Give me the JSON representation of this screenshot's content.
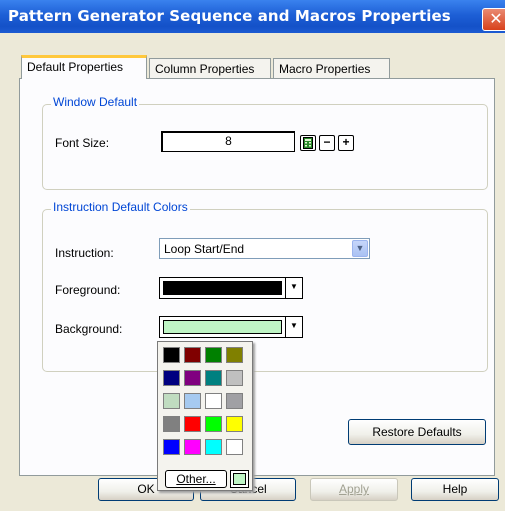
{
  "window": {
    "title": "Pattern Generator Sequence and Macros Properties",
    "close_glyph": "✕"
  },
  "tabs": [
    {
      "label": "Default Properties",
      "active": true
    },
    {
      "label": "Column Properties",
      "active": false
    },
    {
      "label": "Macro Properties",
      "active": false
    }
  ],
  "window_default": {
    "group_label": "Window Default",
    "font_size_label": "Font Size:",
    "font_size_value": "8",
    "calc_icon": "calculator-icon",
    "minus_label": "−",
    "plus_label": "+"
  },
  "instruction_colors": {
    "group_label": "Instruction Default Colors",
    "instruction_label": "Instruction:",
    "instruction_value": "Loop Start/End",
    "foreground_label": "Foreground:",
    "foreground_color": "#000000",
    "background_label": "Background:",
    "background_color": "#bff5c5"
  },
  "palette": {
    "colors": [
      "#000000",
      "#800000",
      "#008000",
      "#808000",
      "#000080",
      "#800080",
      "#008080",
      "#c0c0c0",
      "#c0dcc0",
      "#a6caf0",
      "#ffffff",
      "#a0a0a4",
      "#808080",
      "#ff0000",
      "#00ff00",
      "#ffff00",
      "#0000ff",
      "#ff00ff",
      "#00ffff",
      "#ffffff"
    ],
    "other_label": "Other...",
    "custom_color": "#bff5c5"
  },
  "buttons": {
    "restore_defaults": "Restore Defaults",
    "ok": "OK",
    "cancel": "Cancel",
    "apply": "Apply",
    "help": "Help"
  }
}
